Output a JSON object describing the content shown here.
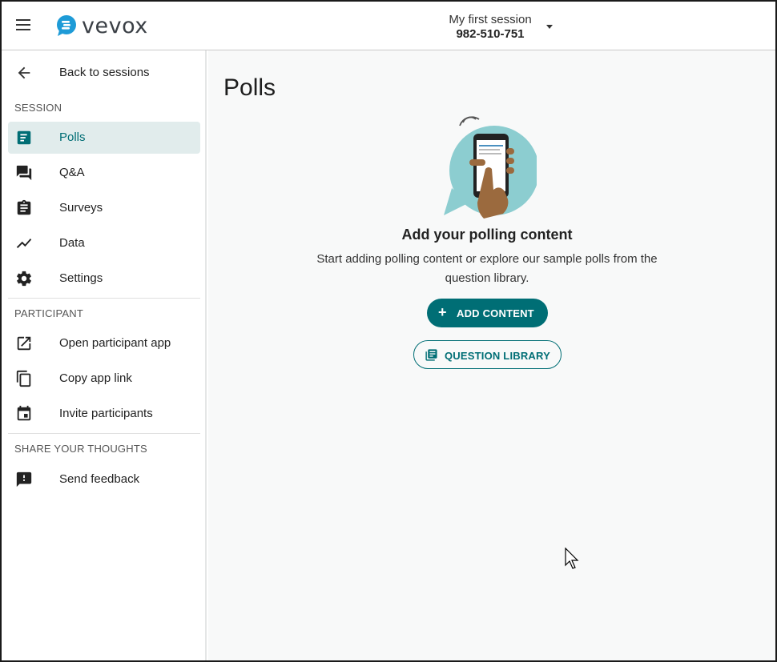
{
  "header": {
    "logo_text": "vevox",
    "session_name": "My first session",
    "session_code": "982-510-751"
  },
  "sidebar": {
    "back_label": "Back to sessions",
    "session_heading": "SESSION",
    "session_items": [
      {
        "label": "Polls",
        "icon": "polls-icon",
        "active": true
      },
      {
        "label": "Q&A",
        "icon": "qa-icon"
      },
      {
        "label": "Surveys",
        "icon": "surveys-icon"
      },
      {
        "label": "Data",
        "icon": "data-icon"
      },
      {
        "label": "Settings",
        "icon": "gear-icon"
      }
    ],
    "participant_heading": "PARTICIPANT",
    "participant_items": [
      {
        "label": "Open participant app",
        "icon": "open-external-icon"
      },
      {
        "label": "Copy app link",
        "icon": "copy-icon"
      },
      {
        "label": "Invite participants",
        "icon": "calendar-icon"
      }
    ],
    "feedback_heading": "SHARE YOUR THOUGHTS",
    "feedback_items": [
      {
        "label": "Send feedback",
        "icon": "feedback-icon"
      }
    ]
  },
  "main": {
    "title": "Polls",
    "empty_title": "Add your polling content",
    "empty_description": "Start adding polling content or explore our sample polls from the question library.",
    "add_button": "ADD CONTENT",
    "library_button": "QUESTION LIBRARY"
  },
  "colors": {
    "accent": "#006e75",
    "active_bg": "#e1ecec",
    "main_bg": "#f8f9f9"
  }
}
